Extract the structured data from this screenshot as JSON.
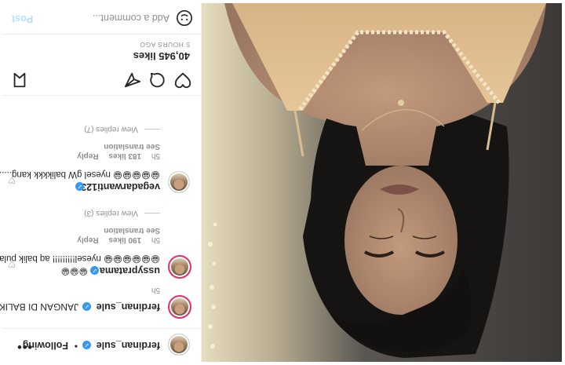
{
  "post": {
    "username": "ferdinan_sule",
    "follow_label": "Following",
    "separator": "•",
    "more_label": "•••",
    "caption_user": "ferdinan_sule",
    "caption_text": "JANGAN DI BALIK YA",
    "caption_age": "5h",
    "likes": "40,945 likes",
    "time_ago": "5 HOURS AGO"
  },
  "comments": [
    {
      "user": "ussypratama",
      "text": "😁😁😁😁😁😁 nyesel!!!!!!!!! aq balik pulak",
      "emoji_line": "😁😁😁",
      "age": "5h",
      "likes": "190 likes",
      "reply": "Reply",
      "translate": "See translation",
      "view_replies": "View replies (3)"
    },
    {
      "user": "vegadarwanti123",
      "text": "😁😁😁😁😁 nyesel gW balikkkk kang........",
      "age": "5h",
      "likes": "183 likes",
      "reply": "Reply",
      "translate": "See translation",
      "view_replies": "View replies (7)"
    }
  ],
  "comment_box": {
    "placeholder": "Add a comment...",
    "post_label": "Post"
  },
  "icons": [
    "heart-icon",
    "comment-icon",
    "share-icon",
    "bookmark-icon",
    "emoji-icon",
    "verified-badge-icon",
    "more-options-icon"
  ],
  "colors": {
    "verified": "#3897f0",
    "story_ring": "#e1306c",
    "post_button": "#b2dffc",
    "muted": "#8e8e8e"
  }
}
